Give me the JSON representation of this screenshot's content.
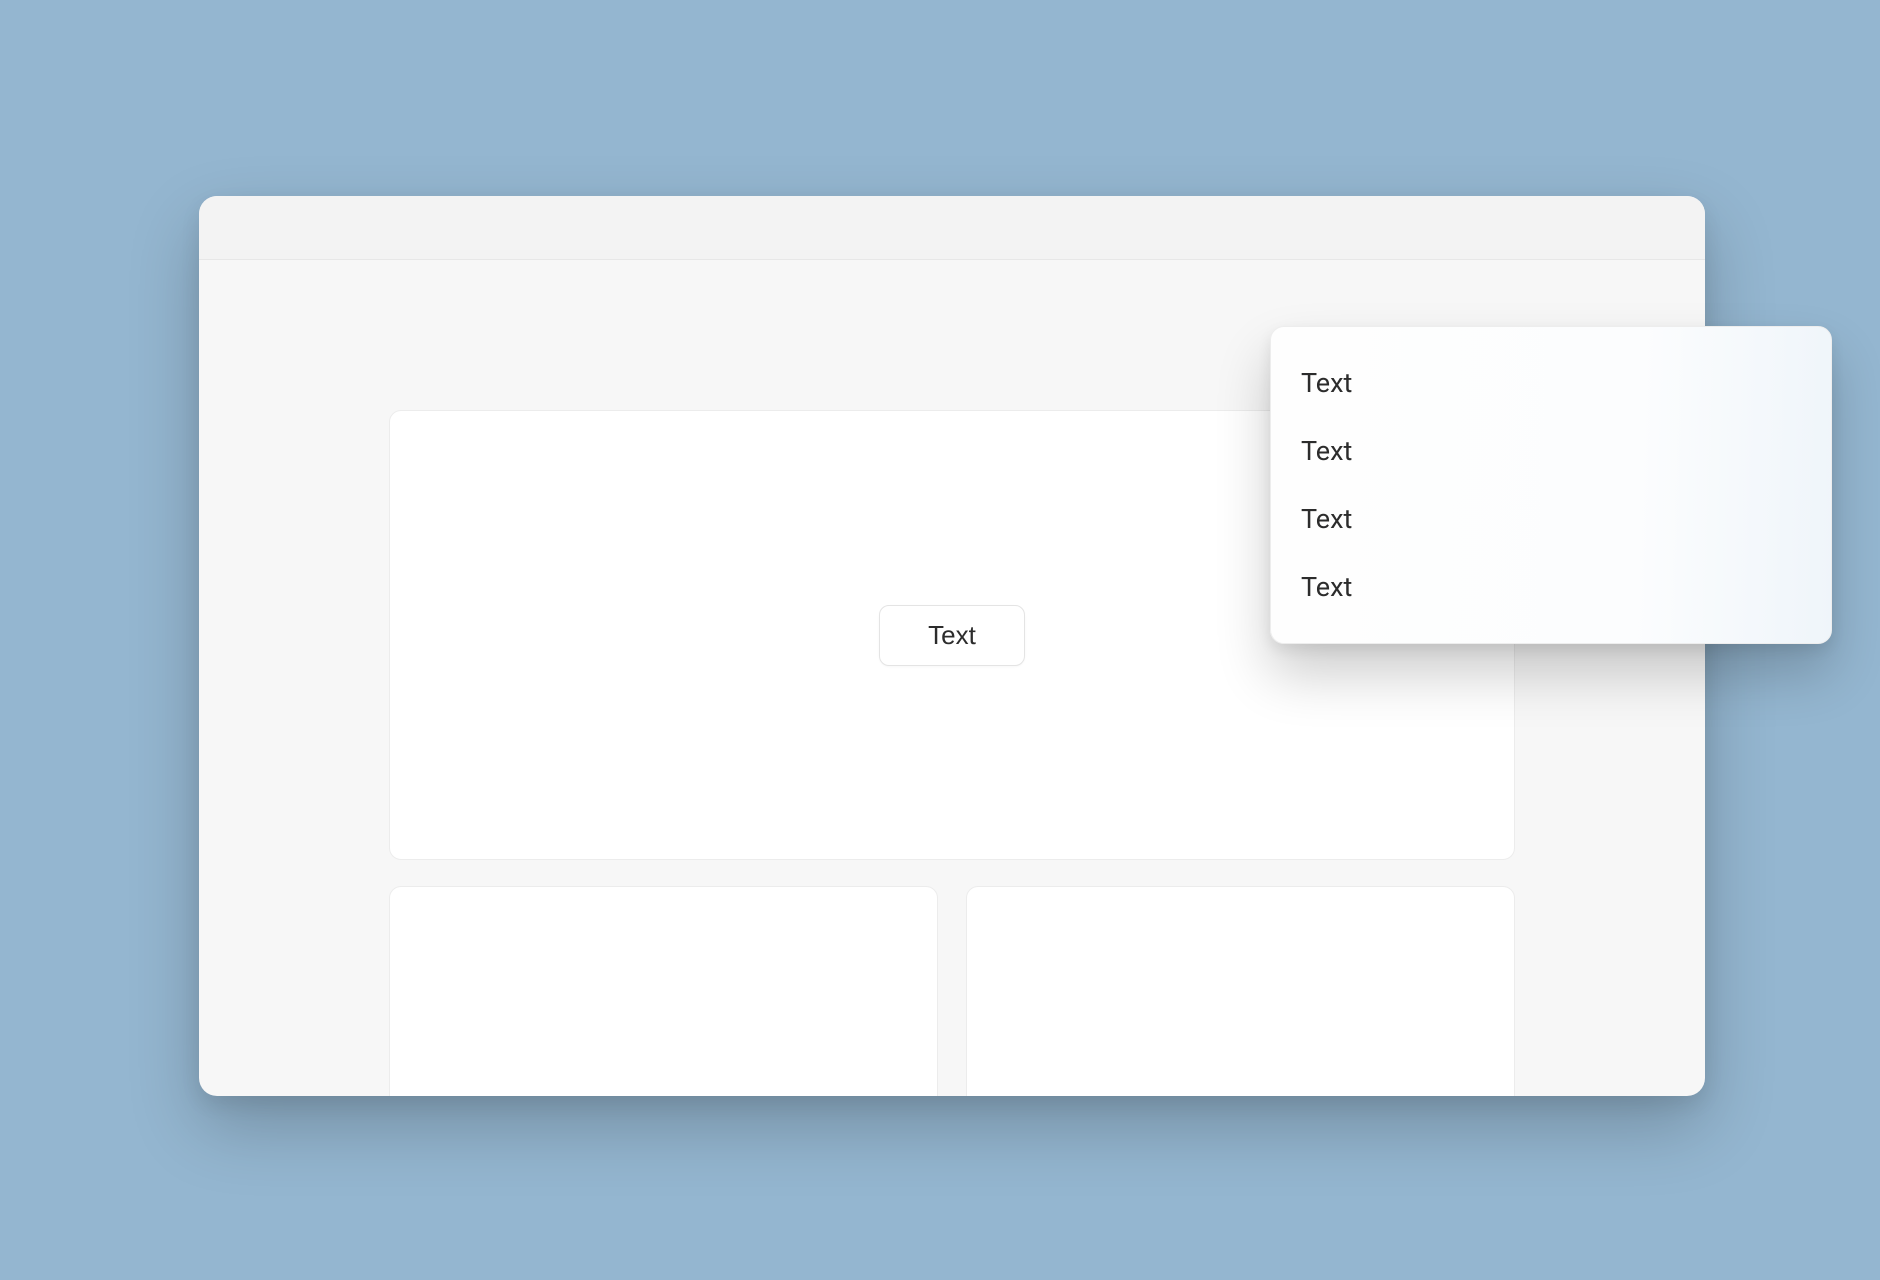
{
  "main": {
    "button_label": "Text"
  },
  "menu": {
    "items": [
      {
        "label": "Text"
      },
      {
        "label": "Text"
      },
      {
        "label": "Text"
      },
      {
        "label": "Text"
      }
    ]
  }
}
